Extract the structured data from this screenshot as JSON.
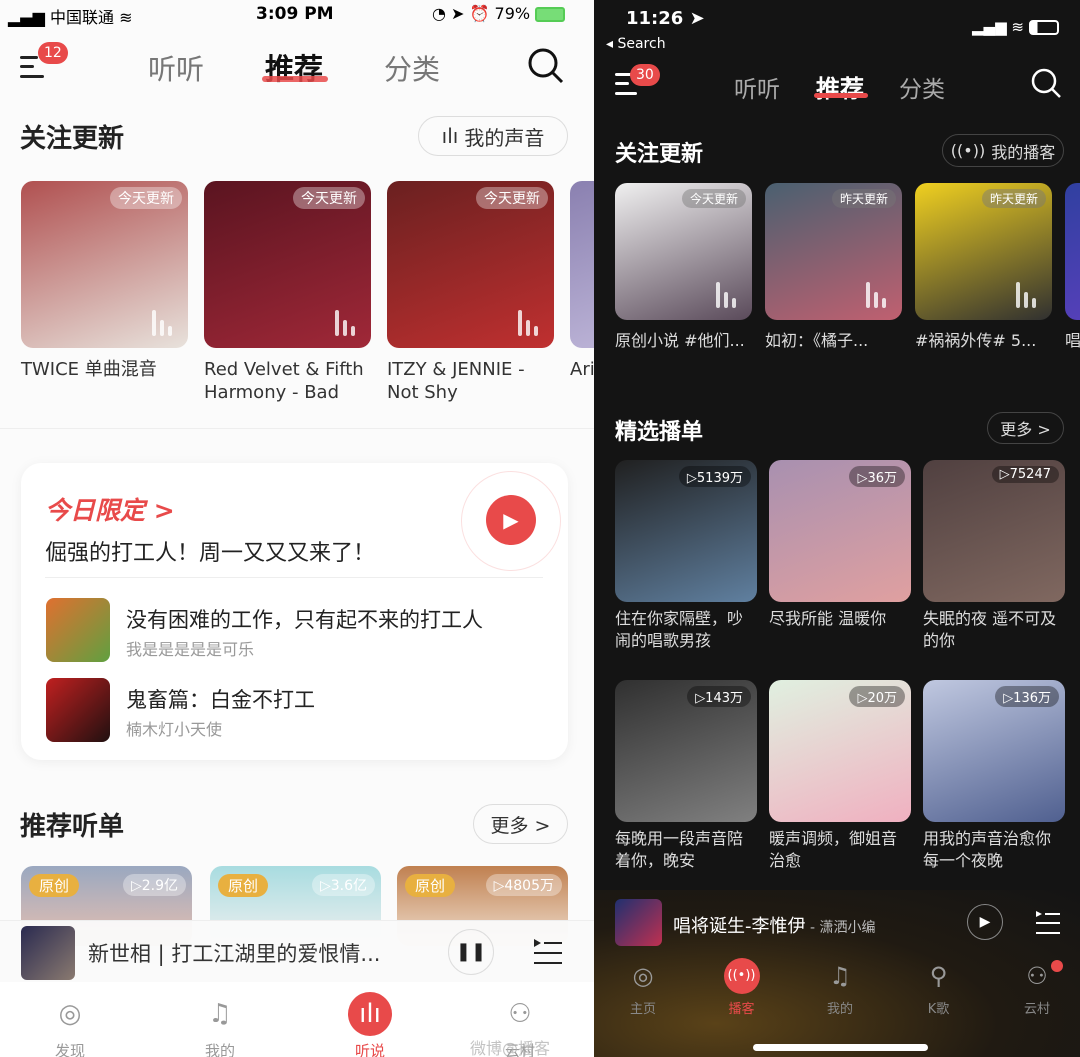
{
  "left": {
    "status": {
      "carrier": "中国联通",
      "time": "3:09 PM",
      "battery": "79%"
    },
    "nav": {
      "badge": "12",
      "tabs": [
        "听听",
        "推荐",
        "分类"
      ],
      "active": 1
    },
    "follow": {
      "title": "关注更新",
      "button": "我的声音",
      "cards": [
        {
          "tag": "今天更新",
          "label": "TWICE 单曲混音",
          "c1": "#b05050",
          "c2": "#e8e2dc"
        },
        {
          "tag": "今天更新",
          "label": "Red Velvet & Fifth Harmony - Bad",
          "c1": "#5a1420",
          "c2": "#a02838"
        },
        {
          "tag": "今天更新",
          "label": "ITZY & JENNIE - Not Shy",
          "c1": "#6a2020",
          "c2": "#c03030"
        },
        {
          "tag": "",
          "label": "Ari Jor",
          "c1": "#8a80b0",
          "c2": "#c8c0e0"
        }
      ]
    },
    "today": {
      "kicker": "今日限定 >",
      "title": "倔强的打工人！周一又又又来了！",
      "items": [
        {
          "title": "没有困难的工作，只有起不来的打工人",
          "sub": "我是是是是是可乐",
          "c1": "#e07030",
          "c2": "#60a040"
        },
        {
          "title": "鬼畜篇：白金不打工",
          "sub": "楠木灯小天使",
          "c1": "#c02020",
          "c2": "#201010"
        }
      ]
    },
    "rec": {
      "title": "推荐听单",
      "more": "更多 >",
      "cards": [
        {
          "tag": "原创",
          "count": "▷2.9亿",
          "c1": "#9aa8c0",
          "c2": "#e8c0b0"
        },
        {
          "tag": "原创",
          "count": "▷3.6亿",
          "c1": "#a8dce0",
          "c2": "#f0f0f0"
        },
        {
          "tag": "原创",
          "count": "▷4805万",
          "c1": "#c08050",
          "c2": "#f0e0d0"
        }
      ]
    },
    "player": {
      "title": "新世相 | 打工江湖里的爱恨情..."
    },
    "tabbar": [
      {
        "label": "发现",
        "icon": "netease-logo-icon"
      },
      {
        "label": "我的",
        "icon": "music-note-icon"
      },
      {
        "label": "听说",
        "icon": "soundwave-icon"
      },
      {
        "label": "云村",
        "icon": "people-icon"
      }
    ],
    "activeTab": 2,
    "watermark": "微博@播客"
  },
  "right": {
    "status": {
      "time": "11:26",
      "back": "◂ Search"
    },
    "nav": {
      "badge": "30",
      "tabs": [
        "听听",
        "推荐",
        "分类"
      ],
      "active": 1
    },
    "follow": {
      "title": "关注更新",
      "button": "我的播客",
      "cards": [
        {
          "tag": "今天更新",
          "label": "原创小说 #他们...",
          "c1": "#f0f0f0",
          "c2": "#5a4a5a"
        },
        {
          "tag": "昨天更新",
          "label": "如初：《橘子...",
          "c1": "#4a6070",
          "c2": "#c06070"
        },
        {
          "tag": "昨天更新",
          "label": "#祸祸外传# 5...",
          "c1": "#f0d020",
          "c2": "#303030"
        },
        {
          "tag": "",
          "label": "唱",
          "c1": "#3040a0",
          "c2": "#6040c0"
        }
      ]
    },
    "picks": {
      "title": "精选播单",
      "more": "更多 >",
      "cards": [
        {
          "count": "▷5139万",
          "label": "住在你家隔壁，吵闹的唱歌男孩",
          "c1": "#202020",
          "c2": "#6080a0"
        },
        {
          "count": "▷36万",
          "label": "尽我所能 温暖你",
          "c1": "#a890b0",
          "c2": "#e0a0a0"
        },
        {
          "count": "▷75247",
          "label": "失眠的夜 遥不可及的你",
          "c1": "#504040",
          "c2": "#806860"
        },
        {
          "count": "▷143万",
          "label": "每晚用一段声音陪着你，晚安",
          "c1": "#303030",
          "c2": "#808080"
        },
        {
          "count": "▷20万",
          "label": "暖声调频，御姐音治愈",
          "c1": "#e0f0e0",
          "c2": "#f0b0c0"
        },
        {
          "count": "▷136万",
          "label": "用我的声音治愈你每一个夜晚",
          "c1": "#c0c8e0",
          "c2": "#506090"
        }
      ]
    },
    "player": {
      "title": "唱将诞生-李惟伊",
      "author": " - 潇洒小编"
    },
    "tabbar": [
      {
        "label": "主页",
        "icon": "netease-logo-icon"
      },
      {
        "label": "播客",
        "icon": "podcast-icon"
      },
      {
        "label": "我的",
        "icon": "music-note-icon"
      },
      {
        "label": "K歌",
        "icon": "microphone-icon"
      },
      {
        "label": "云村",
        "icon": "people-icon"
      }
    ],
    "activeTab": 1
  },
  "colors": {
    "accent": "#e84a4a"
  }
}
